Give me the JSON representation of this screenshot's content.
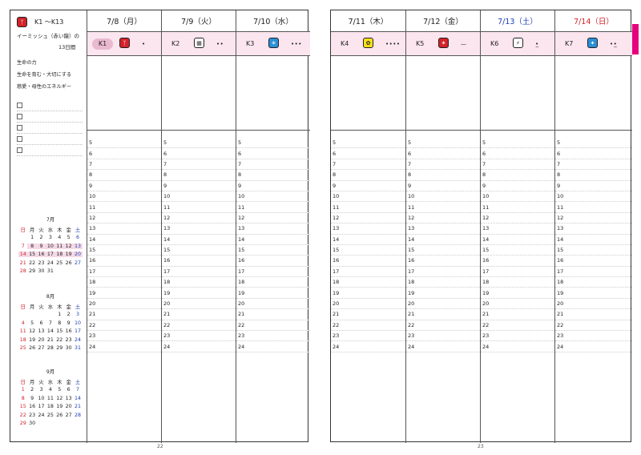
{
  "left_page": {
    "page_number": "22",
    "theme": {
      "glyph_symbol": "ᛉ",
      "range": "K1 ～K13",
      "name": "イーミッシュ（赤い龍）の",
      "days": "13日間",
      "keywords": [
        "生命の力",
        "生命を育む・大切にする",
        "慈愛・母性のエネルギー"
      ]
    },
    "checklist_count": 5,
    "calendars": [
      {
        "title": "7月",
        "weekdays": [
          "日",
          "月",
          "火",
          "水",
          "木",
          "金",
          "土"
        ],
        "weeks": [
          [
            "",
            "",
            "1",
            "2",
            "3",
            "4",
            "5",
            "6"
          ],
          [
            "7",
            "8",
            "9",
            "10",
            "11",
            "12",
            "13"
          ],
          [
            "14",
            "15",
            "16",
            "17",
            "18",
            "19",
            "20"
          ],
          [
            "21",
            "22",
            "23",
            "24",
            "25",
            "26",
            "27"
          ],
          [
            "28",
            "29",
            "30",
            "31",
            "",
            "",
            ""
          ]
        ]
      },
      {
        "title": "8月",
        "weekdays": [
          "日",
          "月",
          "火",
          "水",
          "木",
          "金",
          "土"
        ],
        "weeks": [
          [
            "",
            "",
            "",
            "",
            "1",
            "2",
            "3"
          ],
          [
            "4",
            "5",
            "6",
            "7",
            "8",
            "9",
            "10"
          ],
          [
            "11",
            "12",
            "13",
            "14",
            "15",
            "16",
            "17"
          ],
          [
            "18",
            "19",
            "20",
            "21",
            "22",
            "23",
            "24"
          ],
          [
            "25",
            "26",
            "27",
            "28",
            "29",
            "30",
            "31"
          ]
        ]
      },
      {
        "title": "9月",
        "weekdays": [
          "日",
          "月",
          "火",
          "水",
          "木",
          "金",
          "土"
        ],
        "weeks": [
          [
            "1",
            "2",
            "3",
            "4",
            "5",
            "6",
            "7"
          ],
          [
            "8",
            "9",
            "10",
            "11",
            "12",
            "13",
            "14"
          ],
          [
            "15",
            "16",
            "17",
            "18",
            "19",
            "20",
            "21"
          ],
          [
            "22",
            "23",
            "24",
            "25",
            "26",
            "27",
            "28"
          ],
          [
            "29",
            "30",
            "",
            "",
            "",
            "",
            ""
          ]
        ]
      }
    ]
  },
  "right_page": {
    "page_number": "23"
  },
  "hours": [
    "5",
    "6",
    "7",
    "8",
    "9",
    "10",
    "11",
    "12",
    "13",
    "14",
    "15",
    "16",
    "17",
    "18",
    "19",
    "20",
    "21",
    "22",
    "23",
    "24"
  ],
  "days": [
    {
      "date": "7/8（月）",
      "kin": "K1",
      "tone": "•",
      "glyph_color": "red",
      "glyph_symbol": "ᛉ",
      "date_color": "#222222",
      "oval": true
    },
    {
      "date": "7/9（火）",
      "kin": "K2",
      "tone": "••",
      "glyph_color": "white",
      "glyph_symbol": "▦",
      "date_color": "#222222",
      "oval": false
    },
    {
      "date": "7/10（水）",
      "kin": "K3",
      "tone": "•••",
      "glyph_color": "blue",
      "glyph_symbol": "✳",
      "date_color": "#222222",
      "oval": false
    },
    {
      "date": "7/11（木）",
      "kin": "K4",
      "tone": "••••",
      "glyph_color": "yellow",
      "glyph_symbol": "✿",
      "date_color": "#222222",
      "oval": false
    },
    {
      "date": "7/12（金）",
      "kin": "K5",
      "tone": "—",
      "glyph_color": "red",
      "glyph_symbol": "✶",
      "date_color": "#222222",
      "oval": false
    },
    {
      "date": "7/13（土）",
      "kin": "K6",
      "tone": "•̲",
      "glyph_color": "white",
      "glyph_symbol": "⚡",
      "date_color": "#1d3fb0",
      "oval": false
    },
    {
      "date": "7/14（日）",
      "kin": "K7",
      "tone": "••̲",
      "glyph_color": "blue",
      "glyph_symbol": "✦",
      "date_color": "#d3232a",
      "oval": false
    }
  ],
  "colors": {
    "accent_pink": "#e6007e",
    "kin_row_bg": "#fbe5ee",
    "sunday_red": "#d3232a",
    "saturday_blue": "#1d3fb0"
  }
}
